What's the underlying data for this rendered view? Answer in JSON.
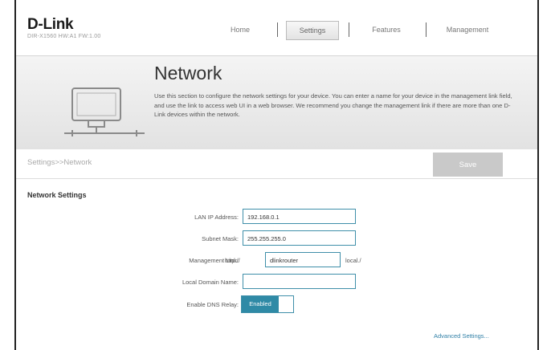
{
  "brand": {
    "logo": "D-Link",
    "model": "DIR-X1560 HW:A1 FW:1.00"
  },
  "nav": {
    "home": "Home",
    "settings": "Settings",
    "features": "Features",
    "management": "Management"
  },
  "hero": {
    "title": "Network",
    "description": "Use this section to configure the network settings for your device. You can enter a name for your device in the management link field, and use the link to access web UI in a web browser. We recommend you change the management link if there are more than one D-Link devices within the network."
  },
  "breadcrumb": "Settings>>Network",
  "save_label": "Save",
  "section_title": "Network Settings",
  "form": {
    "lan_ip_label": "LAN IP Address:",
    "lan_ip_value": "192.168.0.1",
    "subnet_label": "Subnet Mask:",
    "subnet_value": "255.255.255.0",
    "mgmt_label": "Management Link:",
    "mgmt_prefix": "http://",
    "mgmt_value": "dlinkrouter",
    "mgmt_suffix": "local./",
    "domain_label": "Local Domain Name:",
    "domain_value": "",
    "dns_label": "Enable DNS Relay:",
    "dns_state": "Enabled"
  },
  "advanced_link": "Advanced Settings...",
  "icons": {
    "network": "network-computer-icon"
  },
  "colors": {
    "accent": "#2f8aa6",
    "save_disabled": "#c9c9c9"
  }
}
